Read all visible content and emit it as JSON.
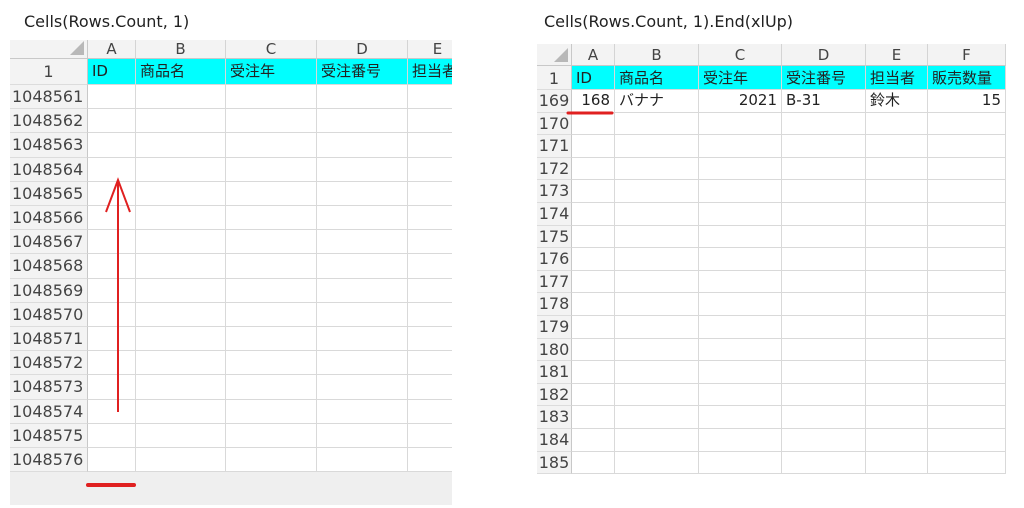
{
  "captions": {
    "left": "Cells(Rows.Count, 1)",
    "right": "Cells(Rows.Count, 1).End(xlUp)"
  },
  "left_sheet": {
    "columns": [
      "A",
      "B",
      "C",
      "D",
      "E"
    ],
    "header_row_number": "1",
    "header_values": [
      "ID",
      "商品名",
      "受注年",
      "受注番号",
      "担当者"
    ],
    "rows": [
      "1048561",
      "1048562",
      "1048563",
      "1048564",
      "1048565",
      "1048566",
      "1048567",
      "1048568",
      "1048569",
      "1048570",
      "1048571",
      "1048572",
      "1048573",
      "1048574",
      "1048575",
      "1048576"
    ]
  },
  "right_sheet": {
    "columns": [
      "A",
      "B",
      "C",
      "D",
      "E",
      "F"
    ],
    "header_row_number": "1",
    "header_values": [
      "ID",
      "商品名",
      "受注年",
      "受注番号",
      "担当者",
      "販売数量"
    ],
    "data_row": {
      "row_number": "169",
      "values": [
        "168",
        "バナナ",
        "2021",
        "B-31",
        "鈴木",
        "15"
      ]
    },
    "empty_rows": [
      "170",
      "171",
      "172",
      "173",
      "174",
      "175",
      "176",
      "177",
      "178",
      "179",
      "180",
      "181",
      "182",
      "183",
      "184",
      "185"
    ]
  },
  "colors": {
    "header_fill": "#00ffff",
    "annotation_red": "#e02020",
    "grid": "#d9d9d9",
    "header_bg": "#f3f3f3"
  }
}
